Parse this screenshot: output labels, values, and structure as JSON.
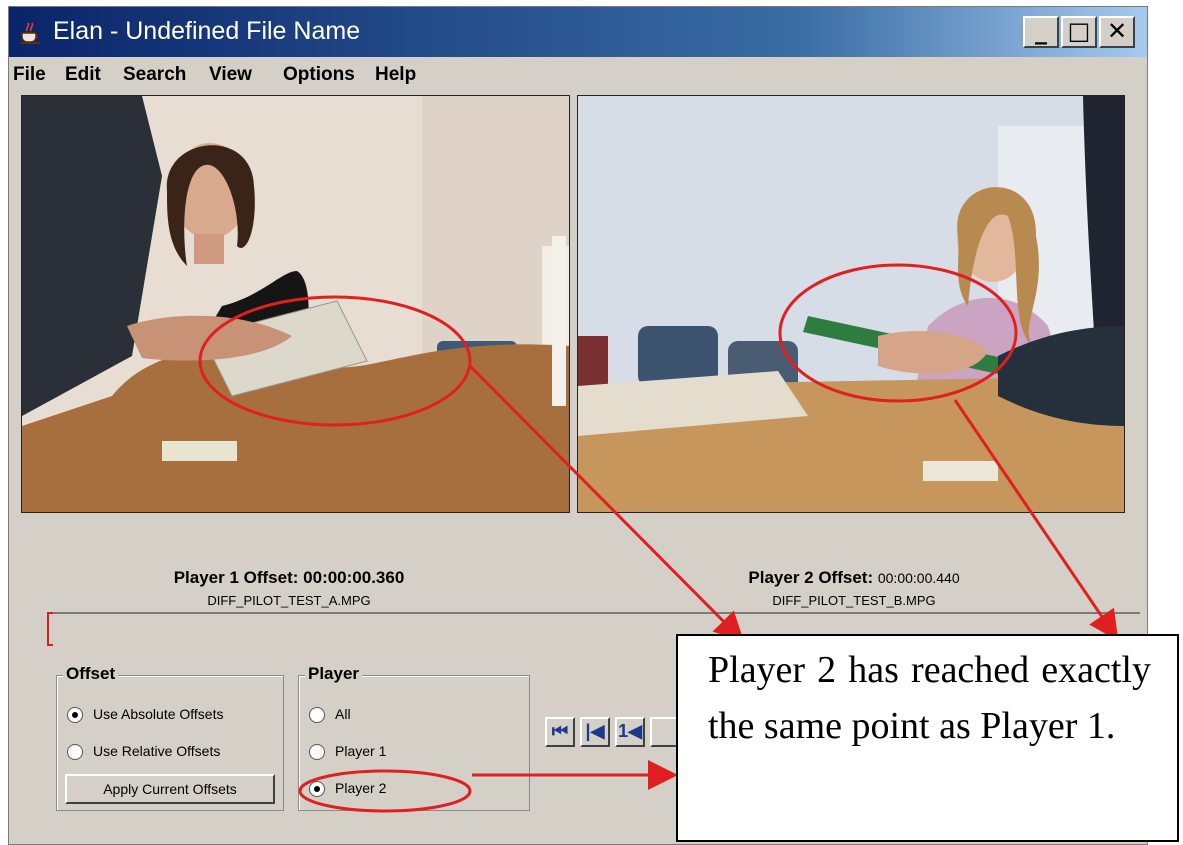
{
  "window": {
    "title": "Elan - Undefined File Name",
    "app_icon": "java-cup-icon",
    "controls": {
      "minimize": "_",
      "maximize": "□",
      "close": "✕"
    }
  },
  "menu": {
    "items": [
      {
        "label": "File"
      },
      {
        "label": "Edit"
      },
      {
        "label": "Search"
      },
      {
        "label": "View"
      },
      {
        "label": "Options"
      },
      {
        "label": "Help"
      }
    ]
  },
  "players": [
    {
      "offset_label": "Player 1 Offset:",
      "offset_value": "00:00:00.360",
      "file": "DIFF_PILOT_TEST_A.MPG"
    },
    {
      "offset_label": "Player 2 Offset:",
      "offset_value": "00:00:00.440",
      "file": "DIFF_PILOT_TEST_B.MPG"
    }
  ],
  "offset_group": {
    "title": "Offset",
    "options": [
      {
        "label": "Use Absolute Offsets",
        "selected": true
      },
      {
        "label": "Use Relative Offsets",
        "selected": false
      }
    ],
    "apply_button": "Apply Current Offsets"
  },
  "player_group": {
    "title": "Player",
    "options": [
      {
        "label": "All",
        "selected": false
      },
      {
        "label": "Player 1",
        "selected": false
      },
      {
        "label": "Player 2",
        "selected": true
      }
    ]
  },
  "playback_controls": [
    {
      "icon": "go-to-begin-icon",
      "glyph": "⏮"
    },
    {
      "icon": "previous-frame-icon",
      "glyph": "|◀"
    },
    {
      "icon": "step-back-icon",
      "glyph": "1◀"
    }
  ],
  "callout": {
    "text": "Player 2 has reached exactly the same point as Player 1."
  },
  "colors": {
    "window_bg": "#d4d0c8",
    "annotation_red": "#e02020",
    "titlebar_start": "#0a246a",
    "titlebar_end": "#a6caf0"
  }
}
